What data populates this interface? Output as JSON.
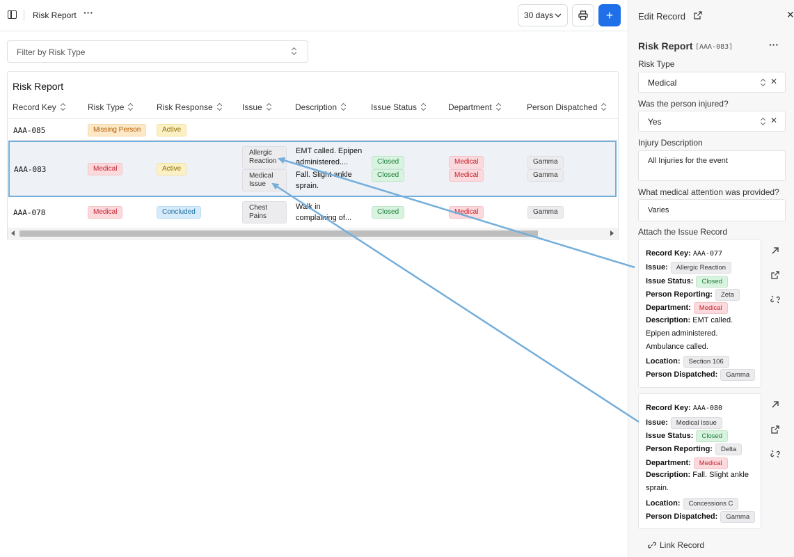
{
  "topbar": {
    "title": "Risk Report",
    "days_label": "30 days",
    "add_label": "+"
  },
  "filter": {
    "placeholder": "Filter by Risk Type"
  },
  "table": {
    "title": "Risk Report",
    "headers": [
      "Record Key",
      "Risk Type",
      "Risk Response",
      "Issue",
      "Description",
      "Issue Status",
      "Department",
      "Person Dispatched"
    ],
    "rows": [
      {
        "key": "AAA-085",
        "risk_type": "Missing Person",
        "risk_response": "Active"
      },
      {
        "key": "AAA-083",
        "risk_type": "Medical",
        "risk_response": "Active",
        "issue1": "Allergic Reaction",
        "issue2": "Medical Issue",
        "desc1": "EMT called. Epipen administered....",
        "desc2": "Fall. Slight ankle sprain.",
        "status1": "Closed",
        "status2": "Closed",
        "dept1": "Medical",
        "dept2": "Medical",
        "person1": "Gamma",
        "person2": "Gamma"
      },
      {
        "key": "AAA-078",
        "risk_type": "Medical",
        "risk_response": "Concluded",
        "issue1": "Chest Pains",
        "desc1": "Walk in complaining of...",
        "status1": "Closed",
        "dept1": "Medical",
        "person1": "Gamma"
      }
    ]
  },
  "panel": {
    "title": "Edit Record",
    "record_title": "Risk Report",
    "record_key": "[AAA-083]",
    "risk_type_label": "Risk Type",
    "risk_type_value": "Medical",
    "injured_label": "Was the person injured?",
    "injured_value": "Yes",
    "injury_desc_label": "Injury Description",
    "injury_desc_value": "All Injuries for the event",
    "medical_label": "What medical attention was provided?",
    "medical_value": "Varies",
    "attach_label": "Attach the Issue Record",
    "link_record_label": "Link Record",
    "cards": [
      {
        "key": "AAA-077",
        "issue": "Allergic Reaction",
        "status": "Closed",
        "reporting": "Zeta",
        "department": "Medical",
        "desc1": "EMT called.",
        "desc2": "Epipen administered.",
        "desc3": "Ambulance called.",
        "location": "Section 106",
        "dispatched": "Gamma"
      },
      {
        "key": "AAA-080",
        "issue": "Medical Issue",
        "status": "Closed",
        "reporting": "Delta",
        "department": "Medical",
        "desc1": "Fall. Slight ankle",
        "desc2": "sprain.",
        "location": "Concessions C",
        "dispatched": "Gamma"
      }
    ],
    "labels": {
      "record_key": "Record Key:",
      "issue": "Issue:",
      "issue_status": "Issue Status:",
      "person_reporting": "Person Reporting:",
      "department": "Department:",
      "description": "Description:",
      "location": "Location:",
      "person_dispatched": "Person Dispatched:"
    }
  },
  "colors": {
    "accent": "#1e6fe8",
    "selection_border": "#74aedb",
    "arrow": "#74aedb"
  }
}
